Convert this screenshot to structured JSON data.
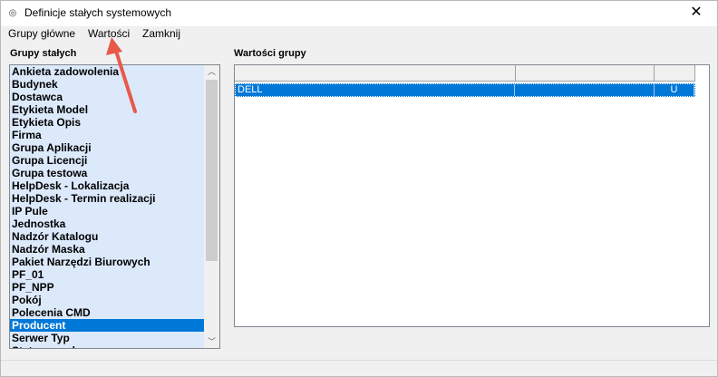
{
  "window": {
    "title": "Definicje stałych systemowych",
    "close_glyph": "X",
    "icon": "app-icon"
  },
  "menu": {
    "items": [
      {
        "label": "Grupy główne"
      },
      {
        "label": "Wartości"
      },
      {
        "label": "Zamknij"
      }
    ]
  },
  "left_panel": {
    "label": "Grupy stałych",
    "items": [
      "Ankieta zadowolenia",
      "Budynek",
      "Dostawca",
      "Etykieta Model",
      "Etykieta Opis",
      "Firma",
      "Grupa Aplikacji",
      "Grupa Licencji",
      "Grupa testowa",
      "HelpDesk - Lokalizacja",
      "HelpDesk - Termin realizacji",
      "IP Pule",
      "Jednostka",
      "Nadzór Katalogu",
      "Nadzór Maska",
      "Pakiet Narzędzi Biurowych",
      "PF_01",
      "PF_NPP",
      "Pokój",
      "Polecenia CMD",
      "Producent",
      "Serwer Typ",
      "Status zasobu"
    ],
    "selected": "Producent"
  },
  "right_panel": {
    "label": "Wartości grupy",
    "rows": [
      {
        "col1": "DELL",
        "col2": "",
        "col3": "U"
      }
    ]
  },
  "colors": {
    "selection": "#0078d7",
    "list_bg": "#dce9fb",
    "annotation_arrow": "#e8594a"
  }
}
